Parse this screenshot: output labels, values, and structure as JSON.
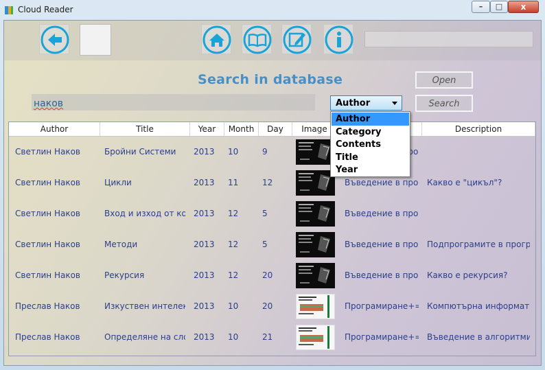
{
  "window": {
    "title": "Cloud Reader",
    "icon": "book-app-icon"
  },
  "controls": {
    "minimize": "–",
    "maximize": "□",
    "close": "x"
  },
  "toolbar": {
    "icons": [
      "back-arrow-icon",
      "home-icon",
      "open-book-icon",
      "edit-icon",
      "info-icon"
    ],
    "accent": "#1aa3d6"
  },
  "search": {
    "heading": "Search in database",
    "query": "наков",
    "field_selected": "Author",
    "field_options": [
      "Author",
      "Category",
      "Contents",
      "Title",
      "Year"
    ],
    "open_label": "Open",
    "search_label": "Search"
  },
  "table": {
    "columns": [
      "Author",
      "Title",
      "Year",
      "Month",
      "Day",
      "Image",
      "",
      "Description"
    ],
    "rows": [
      {
        "author": "Светлин Наков",
        "title": "Бройни Системи",
        "year": "2013",
        "month": "10",
        "day": "9",
        "image": "dark",
        "category": "Въведение в прогр",
        "description": ""
      },
      {
        "author": "Светлин Наков",
        "title": "Цикли",
        "year": "2013",
        "month": "11",
        "day": "12",
        "image": "dark",
        "category": "Въведение в прогр",
        "description": "Какво е \"цикъл\"?"
      },
      {
        "author": "Светлин Наков",
        "title": "Вход и изход от кон",
        "year": "2013",
        "month": "12",
        "day": "5",
        "image": "dark",
        "category": "Въведение в прогр",
        "description": ""
      },
      {
        "author": "Светлин Наков",
        "title": "Методи",
        "year": "2013",
        "month": "12",
        "day": "5",
        "image": "dark",
        "category": "Въведение в прогр",
        "description": "Подпрограмите в прогр"
      },
      {
        "author": "Светлин Наков",
        "title": "Рекурсия",
        "year": "2013",
        "month": "12",
        "day": "20",
        "image": "dark",
        "category": "Въведение в прогр",
        "description": "Какво е рекурсия?"
      },
      {
        "author": "Преслав Наков",
        "title": "Изкуствен интелект",
        "year": "2013",
        "month": "10",
        "day": "20",
        "image": "light",
        "category": "Програмиране+=Алг",
        "description": "Компютърна информати"
      },
      {
        "author": "Преслав Наков",
        "title": "Определяне на слож",
        "year": "2013",
        "month": "10",
        "day": "21",
        "image": "light",
        "category": "Програмиране+=Алг",
        "description": "Въведение в алгоритми"
      }
    ]
  }
}
